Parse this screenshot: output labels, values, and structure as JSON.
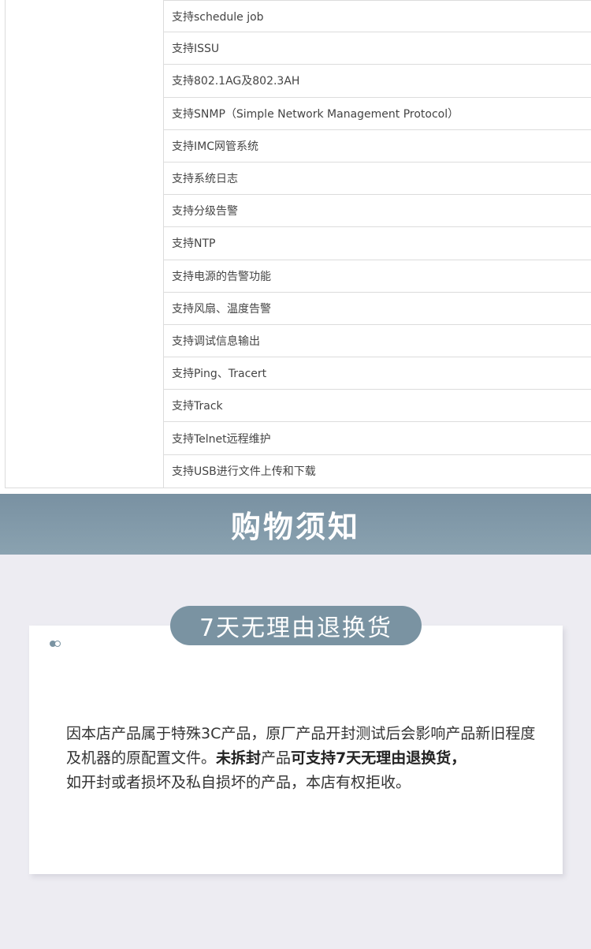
{
  "spec": {
    "rows": [
      "支持schedule job",
      "支持ISSU",
      "支持802.1AG及802.3AH",
      "支持SNMP（Simple Network Management Protocol）",
      "支持IMC网管系统",
      "支持系统日志",
      "支持分级告警",
      "支持NTP",
      "支持电源的告警功能",
      "支持风扇、温度告警",
      "支持调试信息输出",
      "支持Ping、Tracert",
      "支持Track",
      "支持Telnet远程维护",
      "支持USB进行文件上传和下载"
    ]
  },
  "banner": {
    "title": "购物须知"
  },
  "notice": {
    "pill_label": "7天无理由退换货",
    "para_1": "因本店产品属于特殊3C产品，原厂产品开封测试后会影响产品新旧程度及机器的原配置文件。",
    "bold_1": "未拆封",
    "para_2": "产品",
    "bold_2": "可支持7天无理由退换货，",
    "para_3": "如开封或者损坏及私自损坏的产品，本店有权拒收。"
  },
  "colors": {
    "accent": "#7a93a2",
    "banner_top": "#7991a2",
    "banner_bottom": "#8aa2b0",
    "notice_bg": "#edecf2",
    "border": "#dcdcdc"
  }
}
